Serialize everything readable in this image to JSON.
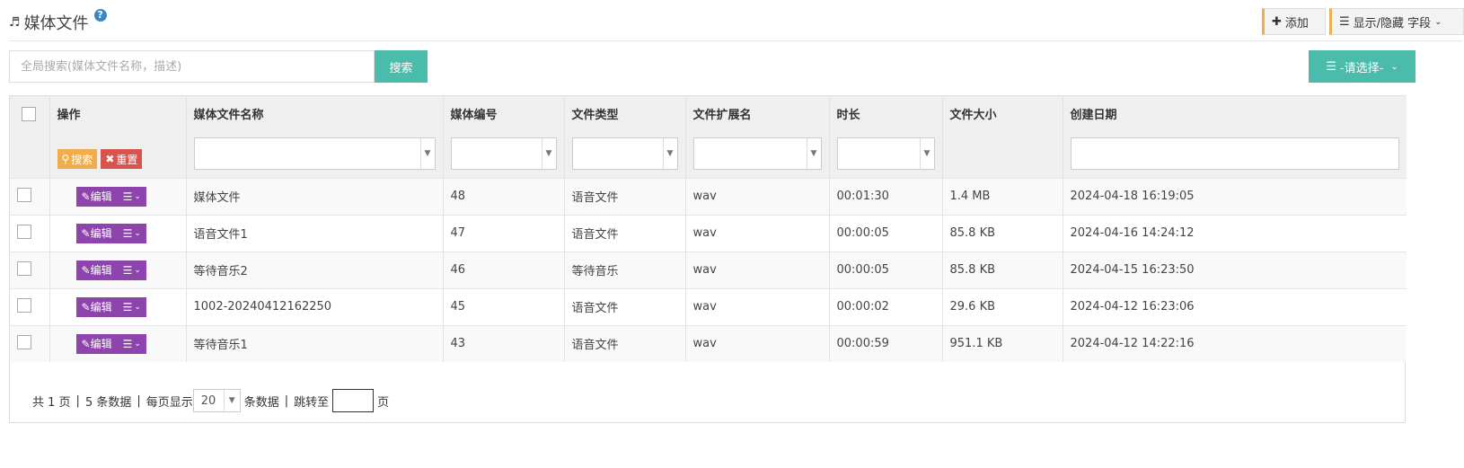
{
  "header": {
    "title": "媒体文件",
    "help_icon": "question-circle-icon",
    "add_label": "添加",
    "fields_label": "显示/隐藏 字段"
  },
  "search": {
    "placeholder": "全局搜索(媒体文件名称，描述)",
    "button_label": "搜索",
    "select_label": "-请选择-"
  },
  "table": {
    "columns": [
      "操作",
      "媒体文件名称",
      "媒体编号",
      "文件类型",
      "文件扩展名",
      "时长",
      "文件大小",
      "创建日期"
    ],
    "filter_search_label": "搜索",
    "filter_reset_label": "重置",
    "edit_label": "编辑",
    "rows": [
      {
        "name": "媒体文件",
        "id": "48",
        "type": "语音文件",
        "ext": "wav",
        "duration": "00:01:30",
        "size": "1.4 MB",
        "created": "2024-04-18 16:19:05"
      },
      {
        "name": "语音文件1",
        "id": "47",
        "type": "语音文件",
        "ext": "wav",
        "duration": "00:00:05",
        "size": "85.8 KB",
        "created": "2024-04-16 14:24:12"
      },
      {
        "name": "等待音乐2",
        "id": "46",
        "type": "等待音乐",
        "ext": "wav",
        "duration": "00:00:05",
        "size": "85.8 KB",
        "created": "2024-04-15 16:23:50"
      },
      {
        "name": "1002-20240412162250",
        "id": "45",
        "type": "语音文件",
        "ext": "wav",
        "duration": "00:00:02",
        "size": "29.6 KB",
        "created": "2024-04-12 16:23:06"
      },
      {
        "name": "等待音乐1",
        "id": "43",
        "type": "语音文件",
        "ext": "wav",
        "duration": "00:00:59",
        "size": "951.1 KB",
        "created": "2024-04-12 14:22:16"
      }
    ]
  },
  "pager": {
    "total_pages": "共 1 页",
    "total_items": "5 条数据",
    "per_page_prefix": "每页显示",
    "per_page_value": "20",
    "per_page_suffix": "条数据",
    "jump_label": "跳转至",
    "page_unit": "页"
  },
  "colors": {
    "accent_teal": "#4bbcab",
    "edit_purple": "#8e44ad",
    "search_orange": "#f0ad4e",
    "reset_red": "#d9534f"
  }
}
